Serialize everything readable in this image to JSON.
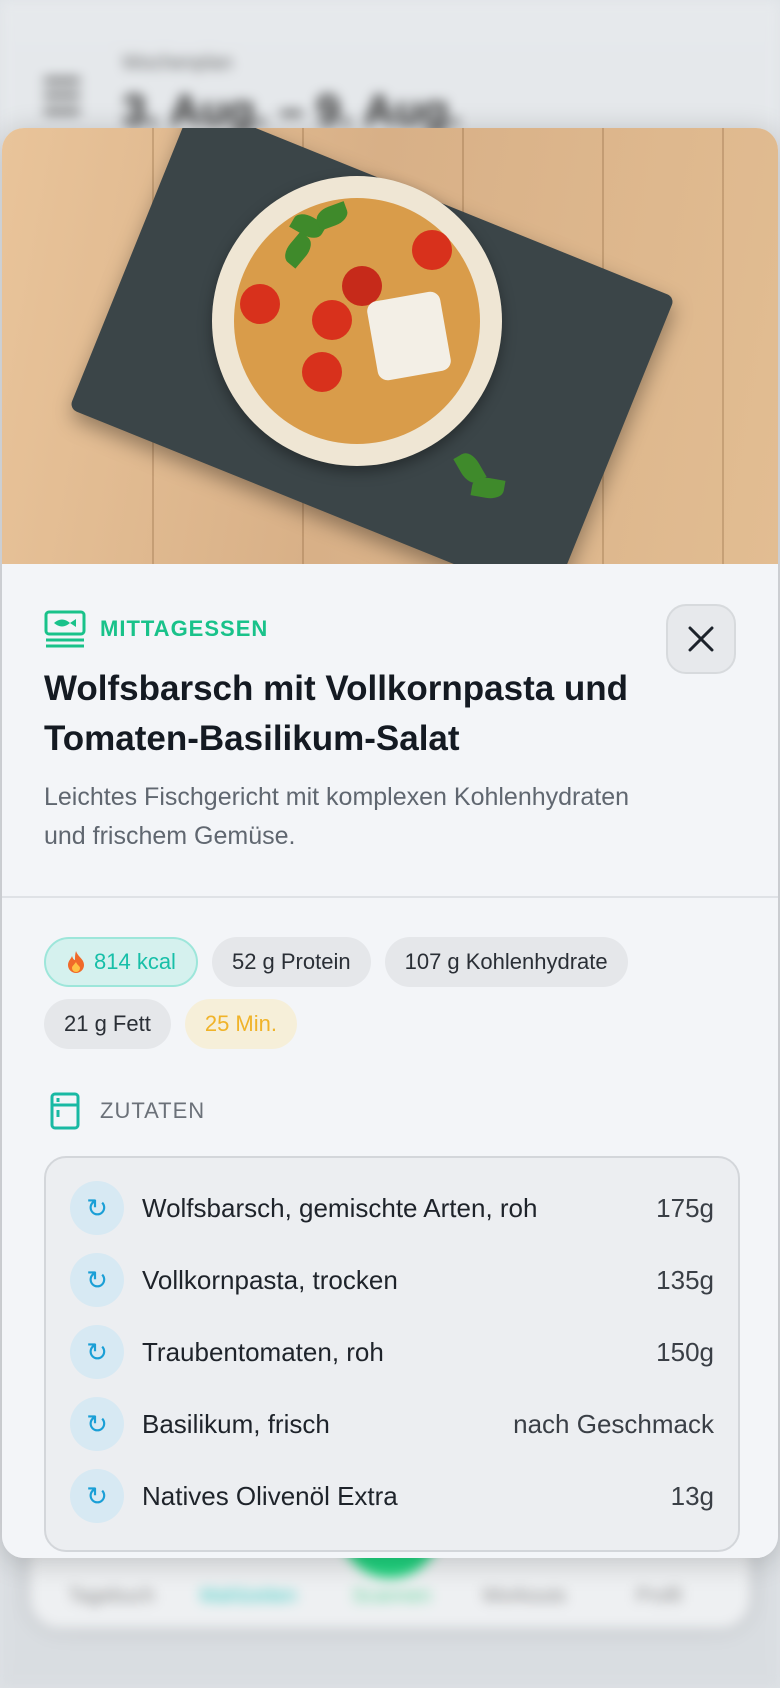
{
  "background": {
    "subtitle": "Wochenplan",
    "title": "3. Aug. – 9. Aug.",
    "nav": [
      "Tagebuch",
      "Mahlzeiten",
      "Scannen",
      "Workouts",
      "Profil"
    ]
  },
  "meal": {
    "category": "MITTAGESSEN",
    "title": "Wolfsbarsch mit Vollkornpasta und Tomaten-Basilikum-Salat",
    "description": "Leichtes Fischgericht mit komplexen Kohlenhydraten und frischem Gemüse.",
    "nutrition": {
      "kcal": "814 kcal",
      "protein": "52 g Protein",
      "carbs": "107 g Kohlenhydrate",
      "fat": "21 g Fett",
      "time": "25 Min."
    },
    "ingredients_label": "ZUTATEN",
    "ingredients": [
      {
        "name": "Wolfsbarsch, gemischte Arten, roh",
        "amount": "175g"
      },
      {
        "name": "Vollkornpasta, trocken",
        "amount": "135g"
      },
      {
        "name": "Traubentomaten, roh",
        "amount": "150g"
      },
      {
        "name": "Basilikum, frisch",
        "amount": "nach Geschmack"
      },
      {
        "name": "Natives Olivenöl Extra",
        "amount": "13g"
      }
    ]
  },
  "icons": {
    "category": "fish-plate-icon",
    "close": "close-icon",
    "kcal": "flame-icon",
    "ingredients": "fridge-icon",
    "swap": "swap-icon"
  },
  "colors": {
    "accent": "#19c28a",
    "kcal": "#17bfa8",
    "time": "#f0b329",
    "swap": "#1a9fd6"
  }
}
